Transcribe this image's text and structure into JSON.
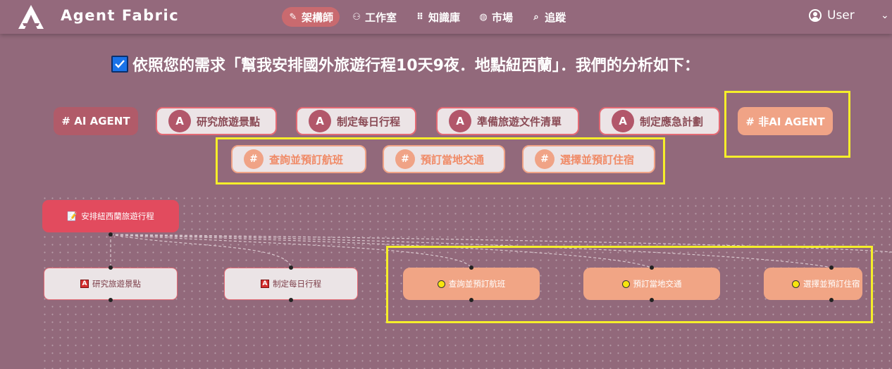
{
  "app": {
    "brand": "Agent Fabric",
    "logo_icon": "agent-fabric-logo-icon"
  },
  "nav": [
    {
      "label": "架構師",
      "icon": "magic-wand-icon",
      "active": true
    },
    {
      "label": "工作室",
      "icon": "people-icon",
      "active": false
    },
    {
      "label": "知識庫",
      "icon": "grid-icon",
      "active": false
    },
    {
      "label": "市場",
      "icon": "globe-icon",
      "active": false
    },
    {
      "label": "追蹤",
      "icon": "search-icon",
      "active": false
    }
  ],
  "user": {
    "label": "User"
  },
  "heading": {
    "text": "依照您的需求「幫我安排國外旅遊行程10天9夜．地點紐西蘭」．我們的分析如下："
  },
  "chips": {
    "ai_header": "# AI AGENT",
    "agents": [
      {
        "badge": "A",
        "label": "研究旅遊景點"
      },
      {
        "badge": "A",
        "label": "制定每日行程"
      },
      {
        "badge": "A",
        "label": "準備旅遊文件清單"
      },
      {
        "badge": "A",
        "label": "制定應急計劃"
      }
    ],
    "nonai_header": "# 非AI AGENT",
    "tasks": [
      {
        "badge": "#",
        "label": "查詢並預訂航班"
      },
      {
        "badge": "#",
        "label": "預訂當地交通"
      },
      {
        "badge": "#",
        "label": "選擇並預訂住宿"
      }
    ]
  },
  "flow": {
    "root": {
      "label": "安排紐西蘭旅遊行程",
      "icon": "document-icon"
    },
    "ai_nodes": [
      {
        "badge": "A",
        "label": "研究旅遊景點"
      },
      {
        "badge": "A",
        "label": "制定每日行程"
      }
    ],
    "non_ai_nodes": [
      {
        "label": "查詢並預訂航班"
      },
      {
        "label": "預訂當地交通"
      },
      {
        "label": "選擇並預訂住宿"
      }
    ]
  },
  "colors": {
    "background": "#92697b",
    "highlight": "#f5ee2a",
    "ai_accent": "#e36a74",
    "non_ai_accent": "#f0a386",
    "root_node": "#e24b5e"
  }
}
